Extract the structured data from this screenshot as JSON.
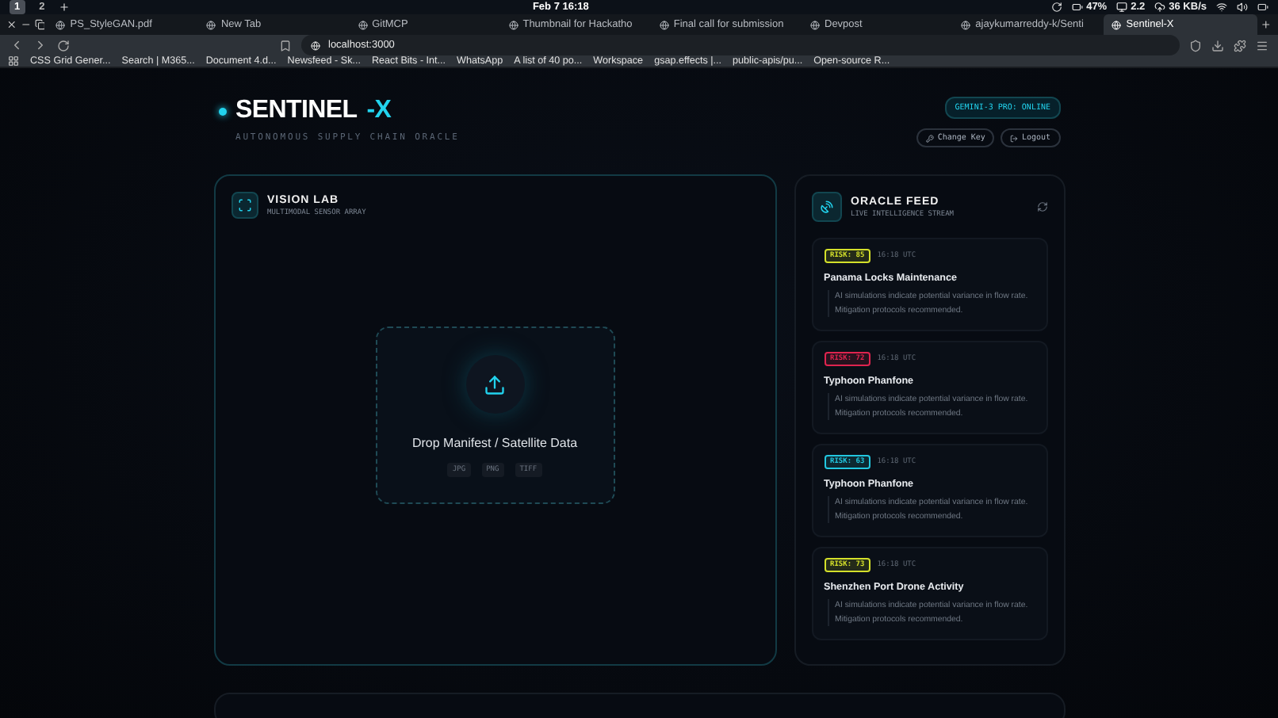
{
  "os_bar": {
    "workspaces": [
      {
        "label": "1",
        "selected": true
      },
      {
        "label": "2",
        "selected": false
      }
    ],
    "clock": "Feb 7  16:18",
    "battery": "47%",
    "load": "2.2",
    "network": "36 KB/s"
  },
  "browser": {
    "tabs": [
      {
        "label": "PS_StyleGAN.pdf",
        "selected": false
      },
      {
        "label": "New Tab",
        "selected": false
      },
      {
        "label": "GitMCP",
        "selected": false
      },
      {
        "label": "Thumbnail for Hackatho",
        "selected": false
      },
      {
        "label": "Final call for submission",
        "selected": false
      },
      {
        "label": "Devpost",
        "selected": false
      },
      {
        "label": "ajaykumarreddy-k/Senti",
        "selected": false
      },
      {
        "label": "Sentinel-X",
        "selected": true
      }
    ],
    "address": "localhost:3000",
    "bookmarks": [
      "CSS Grid Gener...",
      "Search | M365...",
      "Document 4.d...",
      "Newsfeed - Sk...",
      "React Bits - Int...",
      "WhatsApp",
      "A list of 40 po...",
      "Workspace",
      "gsap.effects |...",
      "public-apis/pu...",
      "Open-source R..."
    ]
  },
  "header": {
    "title": "SENTINEL",
    "title_accent": "-X",
    "subtitle": "AUTONOMOUS SUPPLY CHAIN ORACLE",
    "status": "GEMINI-3 PRO: ONLINE",
    "buttons": [
      "Change Key",
      "Logout"
    ]
  },
  "vision_lab": {
    "title": "VISION LAB",
    "subtitle": "MULTIMODAL SENSOR ARRAY",
    "dropzone": {
      "label": "Drop Manifest / Satellite Data",
      "formats": [
        "JPG",
        "PNG",
        "TIFF"
      ]
    }
  },
  "oracle_feed": {
    "title": "ORACLE FEED",
    "subtitle": "LIVE INTELLIGENCE STREAM",
    "items": [
      {
        "risk": "RISK: 85",
        "color": "#d4e02a",
        "time": "16:18 UTC",
        "title": "Panama Locks Maintenance",
        "body": "AI simulations indicate potential variance in flow rate. Mitigation protocols recommended."
      },
      {
        "risk": "RISK: 72",
        "color": "#e0244f",
        "time": "16:18 UTC",
        "title": "Typhoon Phanfone",
        "body": "AI simulations indicate potential variance in flow rate. Mitigation protocols recommended."
      },
      {
        "risk": "RISK: 63",
        "color": "#22c7e0",
        "time": "16:18 UTC",
        "title": "Typhoon Phanfone",
        "body": "AI simulations indicate potential variance in flow rate. Mitigation protocols recommended."
      },
      {
        "risk": "RISK: 73",
        "color": "#d4e02a",
        "time": "16:18 UTC",
        "title": "Shenzhen Port Drone Activity",
        "body": "AI simulations indicate potential variance in flow rate. Mitigation protocols recommended."
      }
    ]
  }
}
